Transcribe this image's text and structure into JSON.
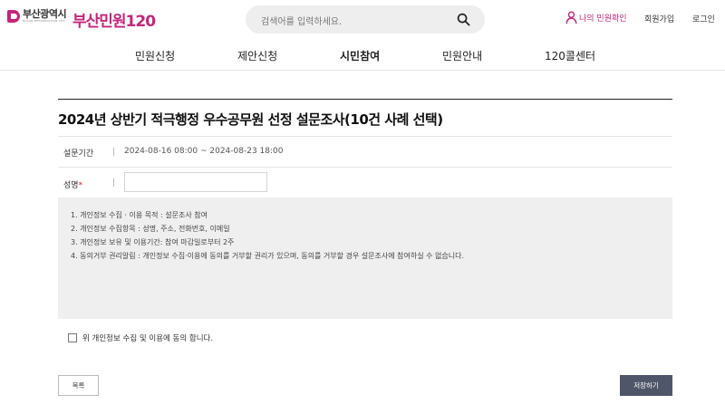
{
  "header": {
    "logo_name": "부산광역시",
    "logo_sub": "BUSAN METROPOLITAN CITY",
    "brand": "부산민원120",
    "search_placeholder": "검색어를 입력하세요.",
    "my_minwon": "나의 민원확인",
    "signup": "회원가입",
    "login": "로그인"
  },
  "nav": {
    "items": [
      {
        "label": "민원신청"
      },
      {
        "label": "제안신청"
      },
      {
        "label": "시민참여"
      },
      {
        "label": "민원안내"
      },
      {
        "label": "120콜센터"
      }
    ],
    "active": "시민참여"
  },
  "survey": {
    "title": "2024년 상반기 적극행정 우수공무원 선정 설문조사(10건 사례 선택)",
    "period_label": "설문기간",
    "period_value": "2024-08-16 08:00 ~ 2024-08-23 18:00",
    "name_label": "성명",
    "name_required_mark": "*",
    "name_value": ""
  },
  "terms": {
    "items": [
      "1. 개인정보 수집 · 이용 목적 : 설문조사 참여",
      "2. 개인정보 수집항목 : 성명, 주소, 전화번호, 이메일",
      "3. 개인정보 보유 및 이용기간: 참여 마감일로부터 2주",
      "4. 동의거부 권리알림 : 개인정보 수집·이용에 동의를 거부할 권리가 있으며, 동의를 거부할 경우 설문조사에 참여하실 수 없습니다."
    ]
  },
  "agree": {
    "label": "위 개인정보 수집 및 이용에 동의 합니다.",
    "checked": false
  },
  "buttons": {
    "list": "목록",
    "save": "저장하기"
  },
  "colors": {
    "brand": "#c4267a",
    "save_button": "#50566a",
    "terms_bg": "#efefef"
  }
}
